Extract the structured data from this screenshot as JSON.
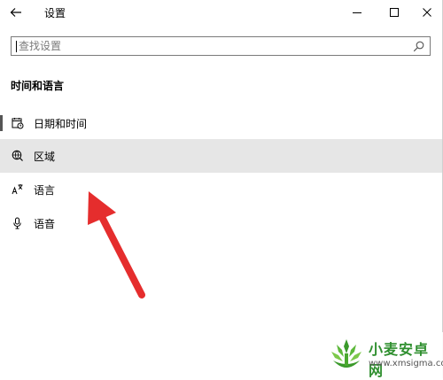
{
  "window": {
    "title": "设置",
    "controls": [
      "minimize",
      "maximize",
      "close"
    ]
  },
  "search": {
    "placeholder": "查找设置",
    "value": ""
  },
  "section": {
    "title": "时间和语言"
  },
  "nav": {
    "items": [
      {
        "label": "日期和时间",
        "icon": "calendar-clock-icon",
        "selected": false
      },
      {
        "label": "区域",
        "icon": "globe-region-icon",
        "selected": true
      },
      {
        "label": "语言",
        "icon": "language-icon",
        "selected": false
      },
      {
        "label": "语音",
        "icon": "microphone-icon",
        "selected": false
      }
    ]
  },
  "annotation": {
    "arrow_color": "#e52d2d",
    "points_to": "语言"
  },
  "watermark": {
    "name": "小麦安卓网",
    "url": "www.xmsigma.com"
  }
}
